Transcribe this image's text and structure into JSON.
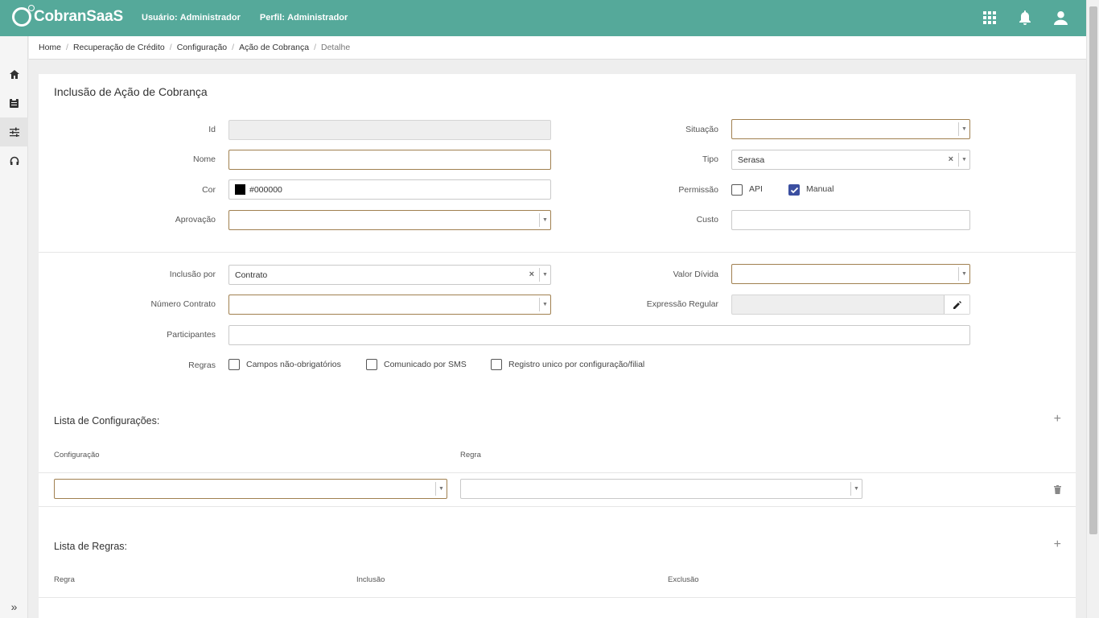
{
  "app": {
    "logo": "CobranSaaS",
    "user_label": "Usuário:",
    "user_value": "Administrador",
    "profile_label": "Perfil:",
    "profile_value": "Administrador"
  },
  "breadcrumb": [
    "Home",
    "Recuperação de Crédito",
    "Configuração",
    "Ação de Cobrança",
    "Detalhe"
  ],
  "breadcrumb_sep": "/",
  "form": {
    "title": "Inclusão de Ação de Cobrança",
    "id_label": "Id",
    "id_value": "",
    "nome_label": "Nome",
    "nome_value": "",
    "cor_label": "Cor",
    "cor_value": "#000000",
    "aprovacao_label": "Aprovação",
    "aprovacao_value": "",
    "situacao_label": "Situação",
    "situacao_value": "",
    "tipo_label": "Tipo",
    "tipo_value": "Serasa",
    "permissao_label": "Permissão",
    "perm_api": "API",
    "perm_manual": "Manual",
    "custo_label": "Custo",
    "custo_value": "",
    "inclusao_label": "Inclusão por",
    "inclusao_value": "Contrato",
    "numero_label": "Número Contrato",
    "numero_value": "",
    "valor_label": "Valor Dívida",
    "valor_value": "",
    "expressao_label": "Expressão Regular",
    "expressao_value": "",
    "participantes_label": "Participantes",
    "participantes_value": "",
    "regras_label": "Regras",
    "regra_1": "Campos não-obrigatórios",
    "regra_2": "Comunicado por SMS",
    "regra_3": "Registro unico por configuração/filial",
    "clear_glyph": "×",
    "arrow_glyph": "▼"
  },
  "states": {
    "perm_api": false,
    "perm_manual": true,
    "regra_1": false,
    "regra_2": false,
    "regra_3": false
  },
  "configs": {
    "title": "Lista de Configurações:",
    "col_config": "Configuração",
    "col_regra": "Regra",
    "add_glyph": "+"
  },
  "rules": {
    "title": "Lista de Regras:",
    "col_regra": "Regra",
    "col_inclusao": "Inclusão",
    "col_exclusao": "Exclusão",
    "add_glyph": "+"
  },
  "sidebar": {
    "expand_glyph": "»"
  },
  "colors": {
    "topbar": "#55a99a",
    "required_border": "#a08050",
    "checkbox_on": "#3b4fa0"
  }
}
